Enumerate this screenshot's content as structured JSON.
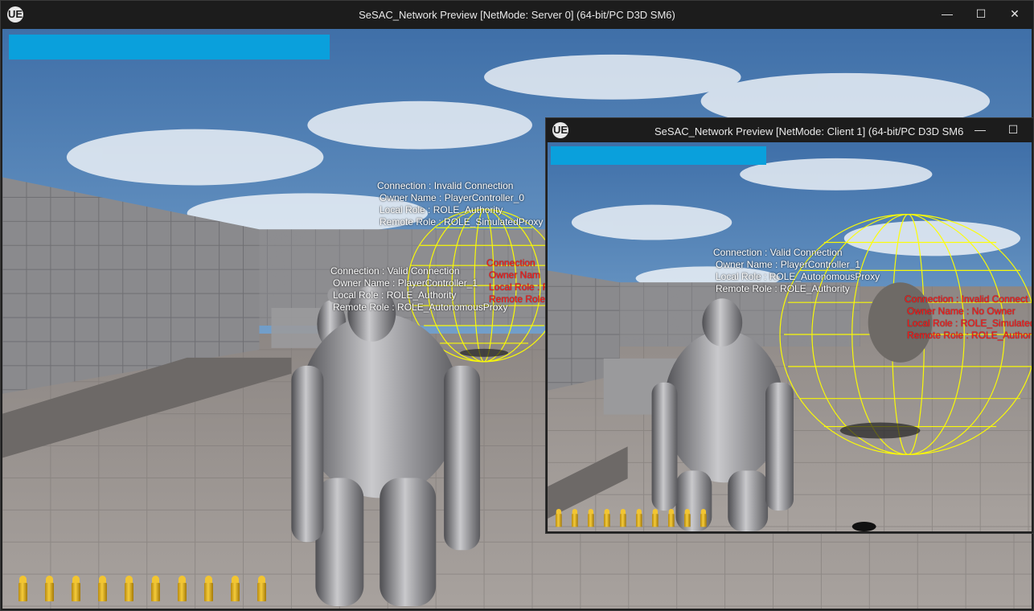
{
  "server": {
    "title": "SeSAC_Network Preview [NetMode: Server 0]  (64-bit/PC D3D SM6)",
    "logo": "UE",
    "controls": {
      "minimize": "—",
      "maximize": "☐",
      "close": "✕"
    },
    "health_fill": 1.0,
    "ammo_count": 10,
    "debug": [
      {
        "lines": [
          "Connection : Invalid Connection",
          "Owner Name : PlayerController_0",
          "Local Role : ROLE_Authority",
          "Remote Role : ROLE_SimulatedProxy"
        ]
      },
      {
        "lines": [
          "Connection : Valid Connection",
          "Owner Name : PlayerController_1",
          "Local Role : ROLE_Authority",
          "Remote Role : ROLE_AutonomousProxy"
        ]
      },
      {
        "lines": [
          "Connection",
          "Owner Nam",
          "Local Role : R",
          "Remote Role"
        ]
      }
    ]
  },
  "client": {
    "title": "SeSAC_Network Preview [NetMode: Client 1]  (64-bit/PC D3D SM6",
    "logo": "UE",
    "controls": {
      "minimize": "—",
      "maximize": "☐"
    },
    "health_fill": 1.0,
    "ammo_count": 10,
    "debug": [
      {
        "lines": [
          "Connection : Valid Connection",
          "Owner Name : PlayerController_1",
          "Local Role : ROLE_AutonomousProxy",
          "Remote Role : ROLE_Authority"
        ]
      },
      {
        "lines": [
          "Connection : Invalid Connect",
          "Owner Name : No Owner",
          "Local Role : ROLE_Simulated",
          "Remote Role : ROLE_Authori"
        ]
      }
    ]
  },
  "colors": {
    "health": "#0aa0dc",
    "debug_text": "#ffffff",
    "debug_red": "#ff1a1a",
    "sphere": "#ffff00",
    "ammo": "#f2c531"
  }
}
